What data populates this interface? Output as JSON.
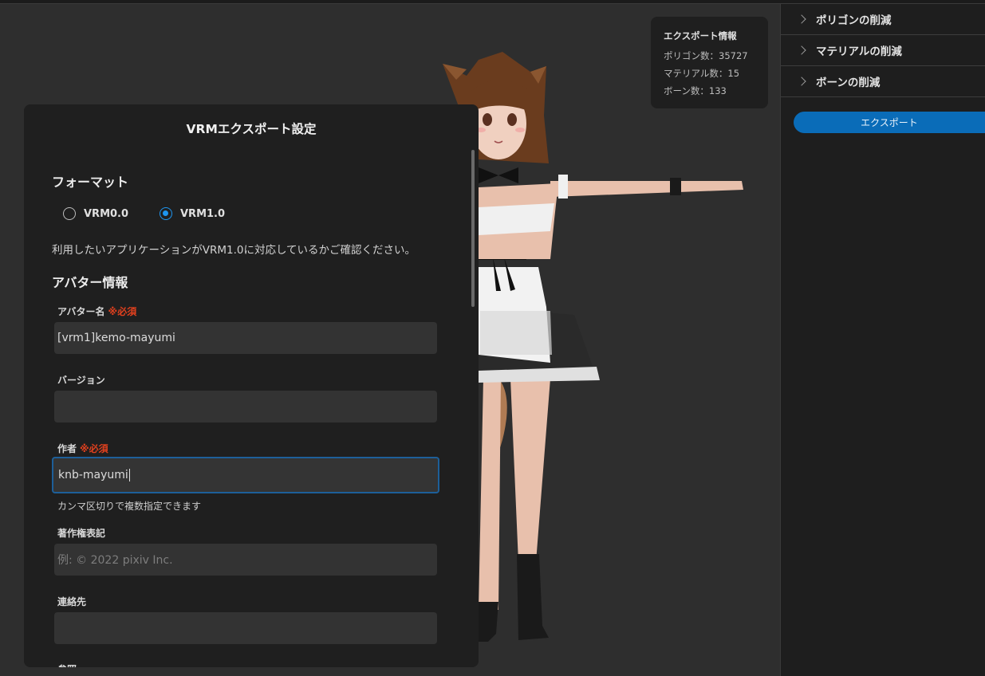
{
  "export_info": {
    "title": "エクスポート情報",
    "polygons": "ポリゴン数：35727",
    "materials": "マテリアル数：15",
    "bones": "ボーン数：133"
  },
  "right_panel": {
    "items": [
      {
        "label": "ポリゴンの削減"
      },
      {
        "label": "マテリアルの削減"
      },
      {
        "label": "ボーンの削減"
      }
    ],
    "export_button": "エクスポート"
  },
  "dialog": {
    "title": "VRMエクスポート設定",
    "format": {
      "heading": "フォーマット",
      "options": [
        "VRM0.0",
        "VRM1.0"
      ],
      "selected": "VRM1.0",
      "note": "利用したいアプリケーションがVRM1.0に対応しているかご確認ください。"
    },
    "avatar_info": {
      "heading": "アバター情報",
      "required_mark": "※必須",
      "name_label": "アバター名",
      "name_value": "[vrm1]kemo-mayumi",
      "version_label": "バージョン",
      "version_value": "",
      "author_label": "作者",
      "author_value": "knb-mayumi",
      "author_hint": "カンマ区切りで複数指定できます",
      "copyright_label": "著作権表記",
      "copyright_placeholder": "例: © 2022 pixiv Inc.",
      "contact_label": "連絡先",
      "contact_value": "",
      "reference_label": "参照"
    }
  },
  "colors": {
    "accent": "#1e96f0",
    "export_button": "#0a6cb8",
    "required": "#e0401e"
  }
}
